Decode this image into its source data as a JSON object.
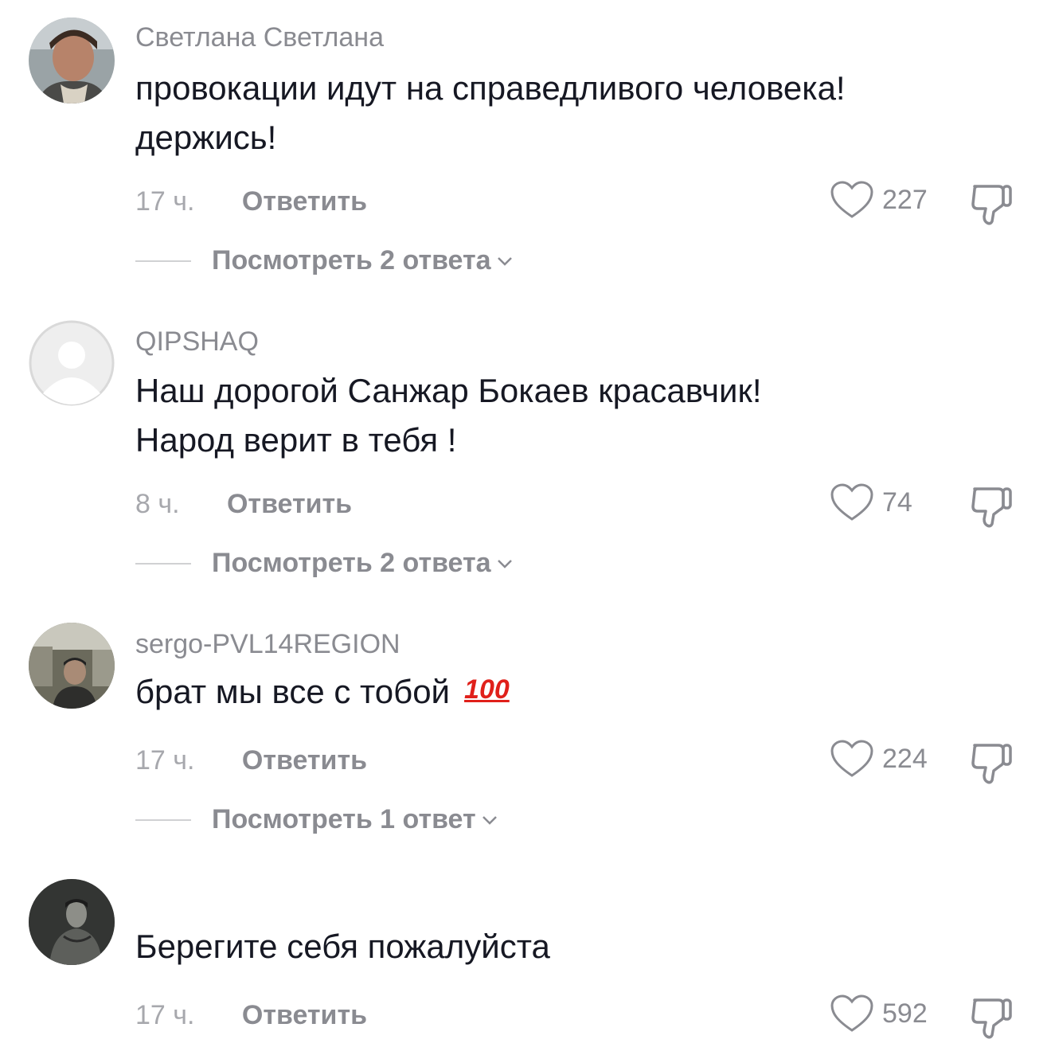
{
  "comments": [
    {
      "username": "Светлана Светлана",
      "text_lines": [
        "провокации идут на справедливого человека!",
        "держись!"
      ],
      "time": "17 ч.",
      "reply_label": "Ответить",
      "likes": "227",
      "view_replies": "Посмотреть 2 ответа"
    },
    {
      "username": "QIPSHAQ",
      "text_lines": [
        "Наш дорогой Санжар Бокаев красавчик!",
        "Народ верит в тебя !"
      ],
      "time": "8 ч.",
      "reply_label": "Ответить",
      "likes": "74",
      "view_replies": "Посмотреть 2 ответа"
    },
    {
      "username": "sergo-PVL14REGION",
      "text_lines": [
        "брат мы все с тобой"
      ],
      "emoji": "💯",
      "emoji_fallback": "100",
      "time": "17 ч.",
      "reply_label": "Ответить",
      "likes": "224",
      "view_replies": "Посмотреть 1 ответ"
    },
    {
      "username": "",
      "text_lines": [
        "Берегите себя пожалуйста"
      ],
      "time": "17 ч.",
      "reply_label": "Ответить",
      "likes": "592"
    }
  ],
  "icons": {
    "like": "heart-outline-icon",
    "dislike": "thumbs-down-outline-icon",
    "expand": "chevron-down-icon"
  },
  "colors": {
    "text_primary": "#161823",
    "text_secondary": "#8a8b91",
    "text_tertiary": "#a7a8ad",
    "emoji_red": "#e0201a"
  }
}
